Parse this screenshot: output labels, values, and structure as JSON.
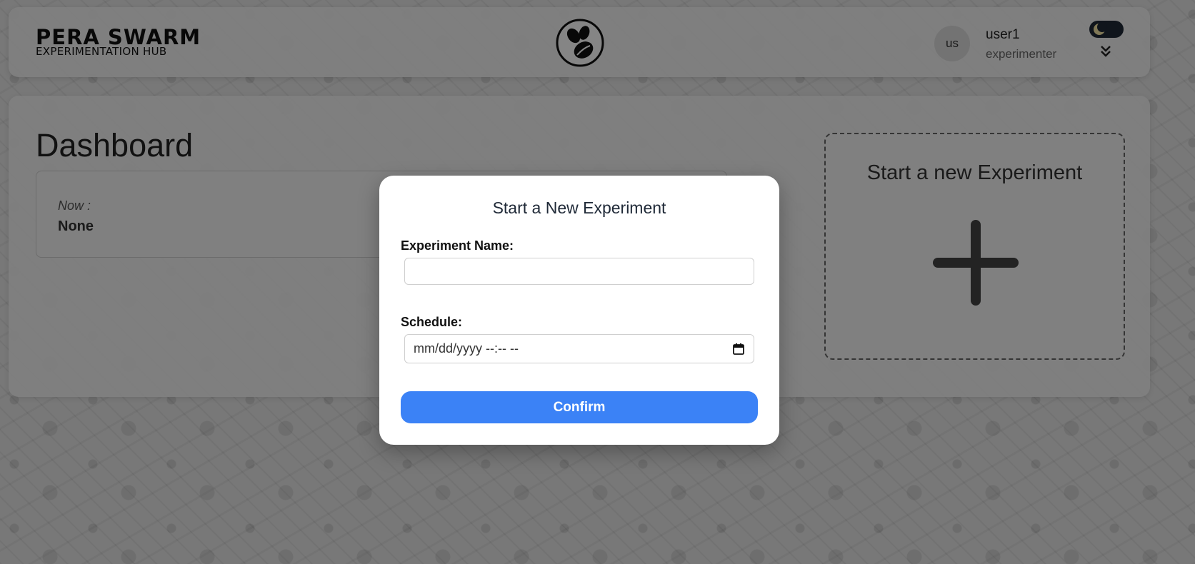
{
  "header": {
    "brand_title": "PERA SWARM",
    "brand_subtitle": "EXPERIMENTATION HUB",
    "logo_icon": "bee-icon",
    "user": {
      "avatar_initials": "us",
      "name": "user1",
      "role": "experimenter"
    },
    "theme_toggle_icon": "moon-icon",
    "menu_icon": "double-chevron-down-icon"
  },
  "dashboard": {
    "title": "Dashboard",
    "now_label": "Now :",
    "now_value": "None",
    "new_experiment_card_title": "Start a new Experiment",
    "new_experiment_icon": "plus-icon"
  },
  "modal": {
    "title": "Start a New Experiment",
    "name_label": "Experiment Name:",
    "name_value": "",
    "schedule_label": "Schedule:",
    "schedule_placeholder": "mm/dd/yyyy --:-- --",
    "calendar_icon": "calendar-icon",
    "confirm_label": "Confirm"
  },
  "colors": {
    "primary": "#3b82f6",
    "toggle_bg": "#1f2937",
    "moon": "#f5e6a8"
  }
}
